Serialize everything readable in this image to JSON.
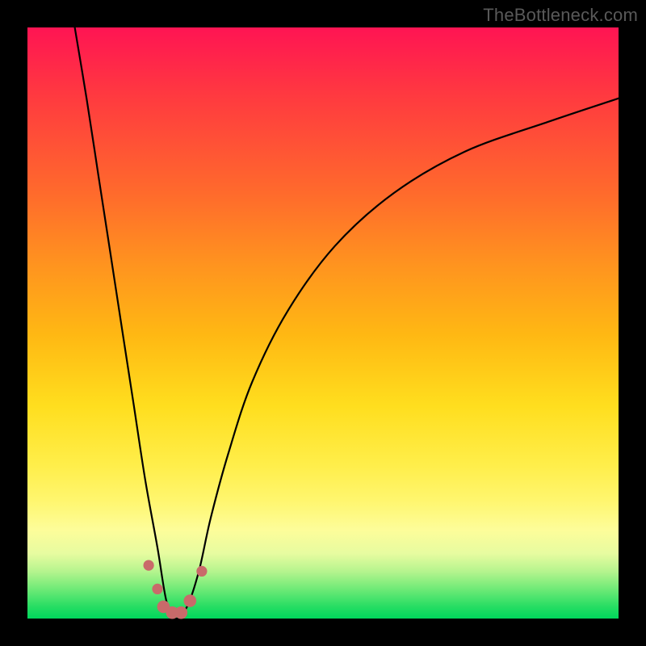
{
  "attribution": "TheBottleneck.com",
  "colors": {
    "frame": "#000000",
    "attribution_text": "#595959",
    "curve_stroke": "#000000",
    "marker_fill": "#c96a6a",
    "gradient_stops": [
      "#ff1453",
      "#ff3b3f",
      "#ff6a2c",
      "#ff931f",
      "#ffb813",
      "#ffde1e",
      "#ffee4a",
      "#fff66e",
      "#fdfd9a",
      "#e7fca0",
      "#b6f48e",
      "#6fea77",
      "#26dd63",
      "#00d75c"
    ]
  },
  "chart_data": {
    "type": "line",
    "title": "",
    "xlabel": "",
    "ylabel": "",
    "xlim": [
      0,
      100
    ],
    "ylim": [
      0,
      100
    ],
    "grid": false,
    "series": [
      {
        "name": "bottleneck-curve",
        "x": [
          8,
          10,
          12,
          14,
          16,
          18,
          20,
          22,
          23.5,
          25,
          27,
          29,
          31,
          34,
          38,
          44,
          52,
          62,
          74,
          88,
          100
        ],
        "y": [
          100,
          88,
          75,
          62,
          49,
          36,
          23,
          12,
          3,
          0,
          2,
          8,
          17,
          28,
          40,
          52,
          63,
          72,
          79,
          84,
          88
        ]
      }
    ],
    "markers": [
      {
        "x": 20.5,
        "y": 9,
        "r": 1.1
      },
      {
        "x": 22.0,
        "y": 5,
        "r": 1.1
      },
      {
        "x": 23.0,
        "y": 2,
        "r": 1.3
      },
      {
        "x": 24.5,
        "y": 1,
        "r": 1.3
      },
      {
        "x": 26.0,
        "y": 1,
        "r": 1.3
      },
      {
        "x": 27.5,
        "y": 3,
        "r": 1.3
      },
      {
        "x": 29.5,
        "y": 8,
        "r": 1.1
      }
    ],
    "note": "Unlabeled bottleneck curve over a green-to-red vertical gradient. Y appears to encode bottleneck percentage (0 good at bottom, 100 bad at top). X has no visible scale; the optimum (valley floor) sits near x≈25 on a 0–100 normalized domain. Small salmon markers cluster around the valley."
  }
}
